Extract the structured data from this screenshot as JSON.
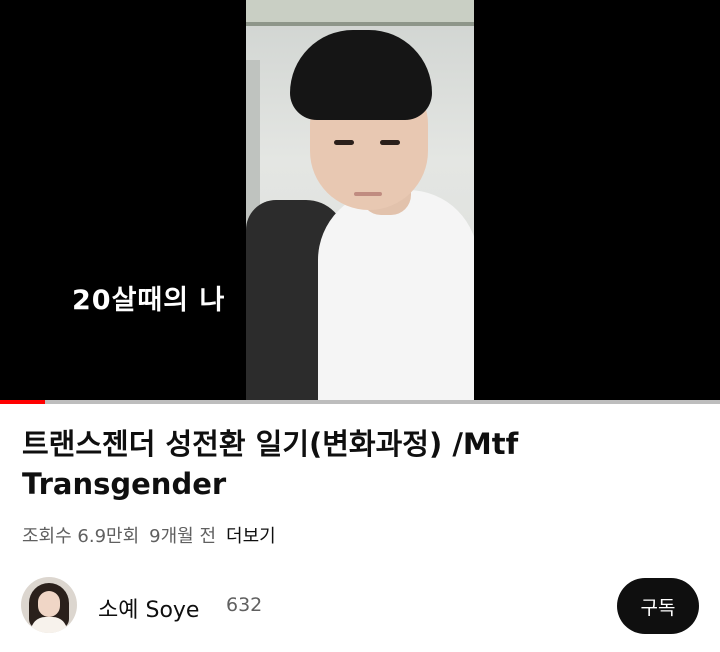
{
  "video": {
    "overlay_text": "20살때의 나",
    "progress_fraction": 0.063
  },
  "title": "트랜스젠더 성전환 일기(변화과정) /Mtf Transgender",
  "meta": {
    "views": "조회수 6.9만회",
    "age": "9개월 전",
    "more": "더보기"
  },
  "channel": {
    "name": "소예 Soye",
    "subscribers": "632",
    "subscribe_label": "구독"
  },
  "colors": {
    "progress": "#ff0000",
    "subscribe_bg": "#0f0f0f"
  }
}
